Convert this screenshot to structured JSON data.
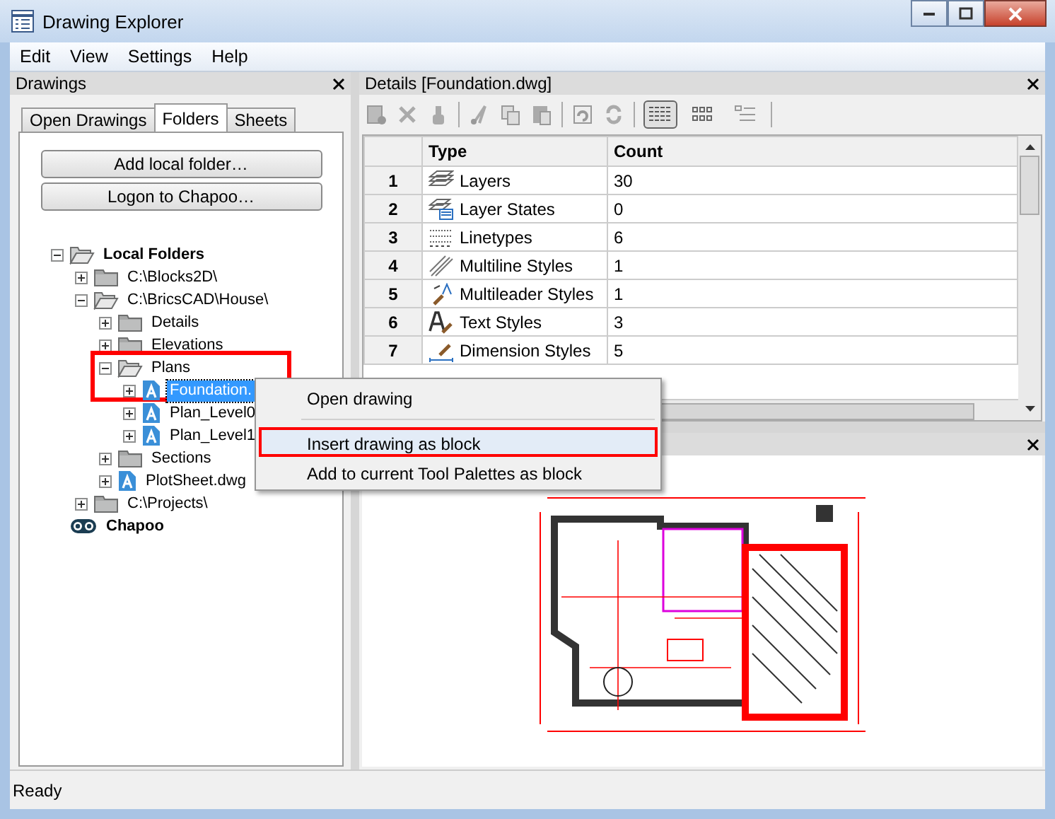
{
  "window": {
    "title": "Drawing Explorer"
  },
  "menu": [
    {
      "label": "Edit"
    },
    {
      "label": "View"
    },
    {
      "label": "Settings"
    },
    {
      "label": "Help"
    }
  ],
  "drawings_panel": {
    "title": "Drawings",
    "tabs": [
      {
        "label": "Open Drawings",
        "selected": false
      },
      {
        "label": "Folders",
        "selected": true
      },
      {
        "label": "Sheets",
        "selected": false
      }
    ],
    "buttons": [
      "Add local folder…",
      "Logon to Chapoo…"
    ],
    "tree": [
      {
        "label": "Local Folders",
        "kind": "root-folder",
        "expanded": true,
        "selected": false,
        "children": [
          {
            "label": "C:\\Blocks2D\\",
            "kind": "folder",
            "expanded": false,
            "selected": false
          },
          {
            "label": "C:\\BricsCAD\\House\\",
            "kind": "folder",
            "expanded": true,
            "selected": false,
            "children": [
              {
                "label": "Details",
                "kind": "folder",
                "expanded": false,
                "selected": false
              },
              {
                "label": "Elevations",
                "kind": "folder",
                "expanded": false,
                "selected": false
              },
              {
                "label": "Plans",
                "kind": "folder",
                "expanded": true,
                "selected": false,
                "highlighted": true,
                "children": [
                  {
                    "label": "Foundation.",
                    "kind": "file",
                    "expanded": false,
                    "selected": true
                  },
                  {
                    "label": "Plan_Level0",
                    "kind": "file",
                    "expanded": false,
                    "selected": false
                  },
                  {
                    "label": "Plan_Level1",
                    "kind": "file",
                    "expanded": false,
                    "selected": false
                  }
                ]
              },
              {
                "label": "Sections",
                "kind": "folder",
                "expanded": false,
                "selected": false
              },
              {
                "label": "PlotSheet.dwg",
                "kind": "file",
                "expanded": false,
                "selected": false
              }
            ]
          },
          {
            "label": "C:\\Projects\\",
            "kind": "folder",
            "expanded": false,
            "selected": false
          }
        ]
      },
      {
        "label": "Chapoo",
        "kind": "cloud",
        "selected": false
      }
    ]
  },
  "details_panel": {
    "title": "Details [Foundation.dwg]",
    "view_modes": [
      {
        "selected": true
      },
      {
        "selected": false
      },
      {
        "selected": false
      }
    ],
    "table": {
      "columns": [
        "Type",
        "Count"
      ],
      "rows": [
        {
          "number": "1",
          "type": "Layers",
          "count": "30",
          "kind": "layers"
        },
        {
          "number": "2",
          "type": "Layer States",
          "count": "0",
          "kind": "layer-states"
        },
        {
          "number": "3",
          "type": "Linetypes",
          "count": "6",
          "kind": "linetypes"
        },
        {
          "number": "4",
          "type": "Multiline Styles",
          "count": "1",
          "kind": "multiline"
        },
        {
          "number": "5",
          "type": "Multileader Styles",
          "count": "1",
          "kind": "multileader"
        },
        {
          "number": "6",
          "type": "Text Styles",
          "count": "3",
          "kind": "text"
        },
        {
          "number": "7",
          "type": "Dimension Styles",
          "count": "5",
          "kind": "dimension"
        }
      ]
    }
  },
  "context_menu": {
    "items": [
      {
        "kind": "item",
        "label": "Open drawing",
        "selected": false,
        "highlighted": false
      },
      {
        "kind": "separator"
      },
      {
        "kind": "item",
        "label": "Insert drawing as block",
        "selected": true,
        "highlighted": true
      },
      {
        "kind": "item",
        "label": "Add to current Tool Palettes as block",
        "selected": false,
        "highlighted": false
      }
    ]
  },
  "status_bar": {
    "text": "Ready"
  }
}
